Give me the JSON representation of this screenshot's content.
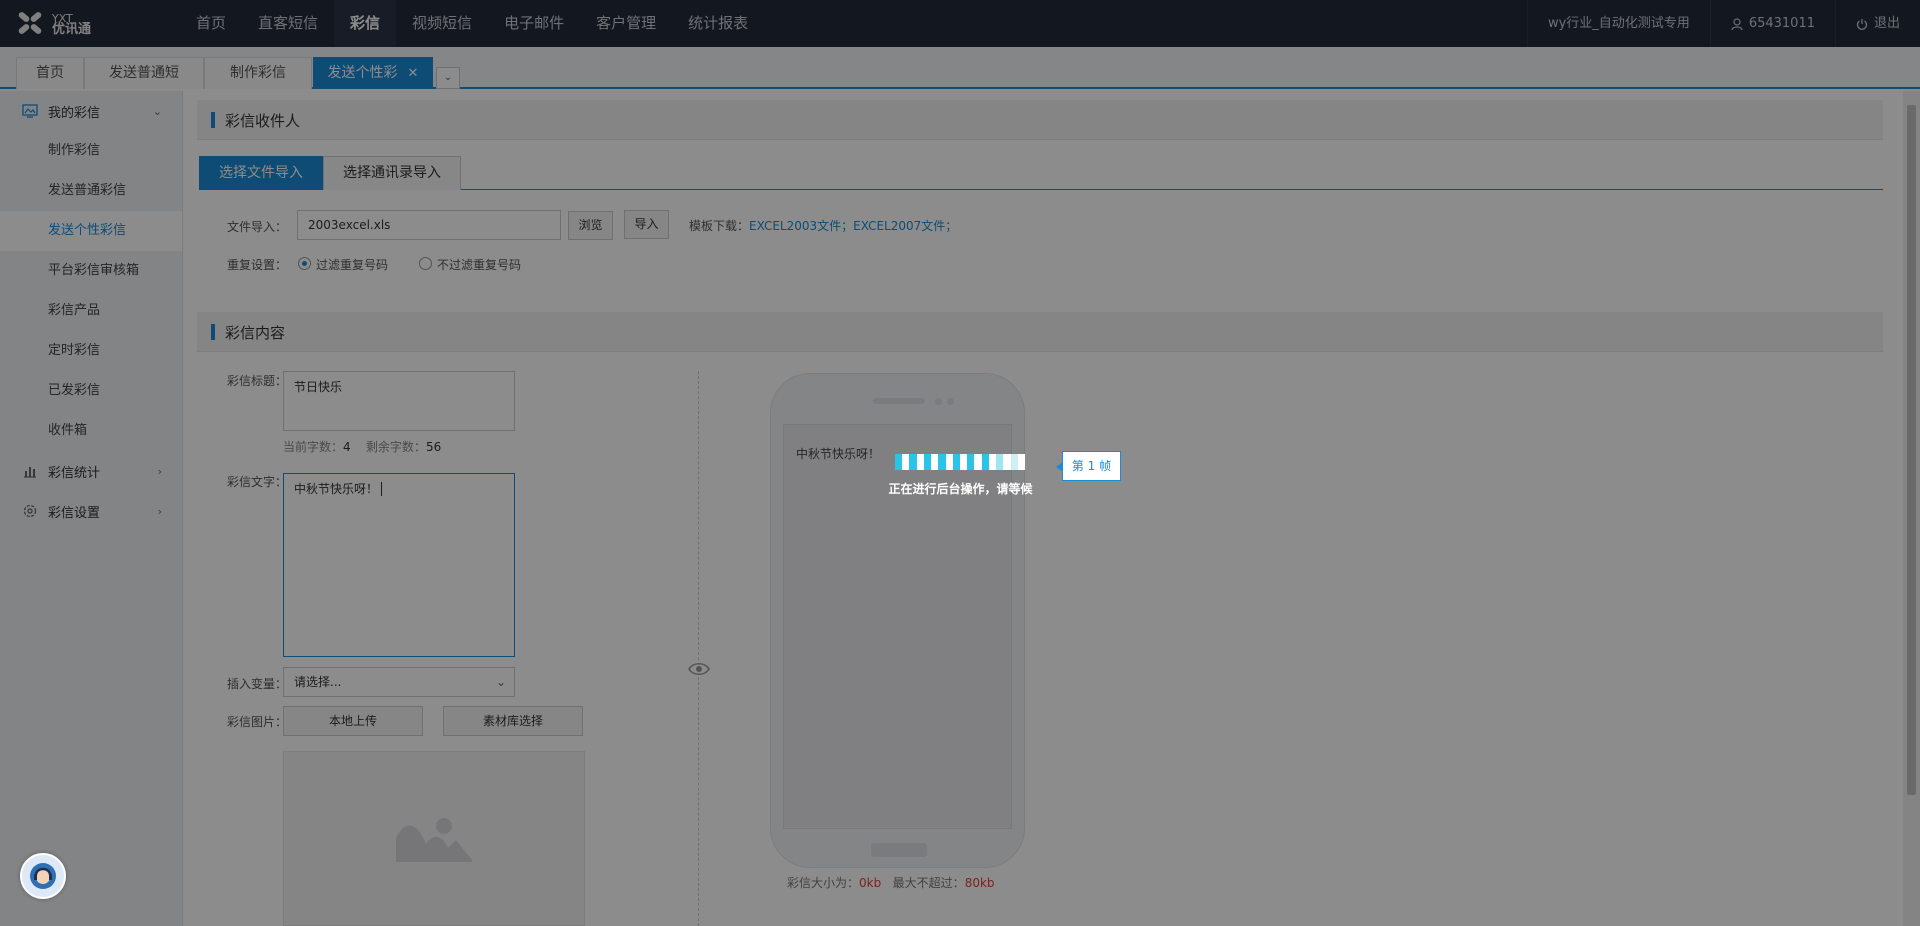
{
  "brand": {
    "logo_top": "YXT",
    "logo_bottom": "优讯通"
  },
  "topnav": {
    "items": [
      "首页",
      "直客短信",
      "彩信",
      "视频短信",
      "电子邮件",
      "客户管理",
      "统计报表"
    ],
    "active_index": 2
  },
  "topright": {
    "company": "wy行业_自动化测试专用",
    "account": "65431011",
    "logout": "退出"
  },
  "tabs": {
    "items": [
      "首页",
      "发送普通短",
      "制作彩信",
      "发送个性彩"
    ],
    "active_index": 3,
    "close_glyph": "✕",
    "more_glyph": "⌄"
  },
  "sidebar": {
    "groups": [
      {
        "label": "我的彩信",
        "icon": "mms-icon",
        "expanded": true
      },
      {
        "label": "彩信统计",
        "icon": "bar-chart-icon",
        "expanded": false
      },
      {
        "label": "彩信设置",
        "icon": "gear-icon",
        "expanded": false
      }
    ],
    "items": [
      "制作彩信",
      "发送普通彩信",
      "发送个性彩信",
      "平台彩信审核箱",
      "彩信产品",
      "定时彩信",
      "已发彩信",
      "收件箱"
    ],
    "active_index": 2
  },
  "recipients": {
    "section_title": "彩信收件人",
    "subtabs": [
      "选择文件导入",
      "选择通讯录导入"
    ],
    "active_subtab": 0,
    "file_label": "文件导入：",
    "file_value": "2003excel.xls",
    "browse_btn": "浏览",
    "import_btn": "导入",
    "template_label": "模板下载：",
    "template_link_2003": "EXCEL2003文件；",
    "template_link_2007": "EXCEL2007文件；",
    "repeat_label": "重复设置：",
    "repeat_opt1": "过滤重复号码",
    "repeat_opt2": "不过滤重复号码",
    "repeat_selected": 0
  },
  "content": {
    "section_title": "彩信内容",
    "title_label": "彩信标题：",
    "title_value": "节日快乐",
    "count_label": "当前字数：",
    "count_value": "4",
    "remain_label": "剩余字数：",
    "remain_value": "56",
    "text_label": "彩信文字：",
    "text_value": "中秋节快乐呀！",
    "var_label": "插入变量：",
    "var_placeholder": "请选择...",
    "image_label": "彩信图片：",
    "local_upload": "本地上传",
    "library_select": "素材库选择"
  },
  "preview": {
    "screen_text": "中秋节快乐呀！",
    "frame_label": "第 1 帧",
    "size_label": "彩信大小为：",
    "size_value": "0kb",
    "max_label": "最大不超过：",
    "max_value": "80kb"
  },
  "loading": {
    "text": "正在进行后台操作，请等候"
  },
  "colors": {
    "accent": "#1a8bd6",
    "topbar": "#232a3a",
    "danger": "#e33c3c",
    "loading_cyan": "#29c5e6"
  }
}
